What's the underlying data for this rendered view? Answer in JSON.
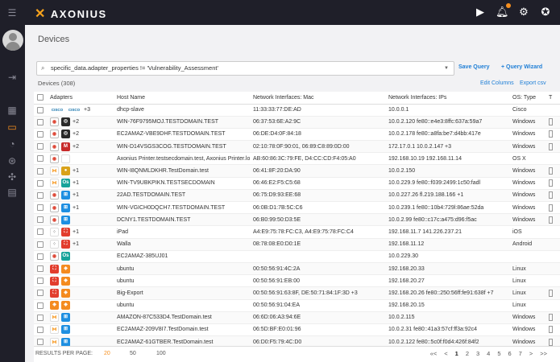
{
  "app": {
    "name": "AXONIUS"
  },
  "page": {
    "title": "Devices"
  },
  "query": {
    "value": "specific_data.adapter_properties != 'Vulnerability_Assessment'"
  },
  "actions": {
    "save_query": "Save Query",
    "query_wizard": "+ Query Wizard",
    "edit_columns": "Edit Columns",
    "export_csv": "Export csv"
  },
  "count_label": "Devices",
  "count_value": "(308)",
  "columns": [
    "Adapters",
    "Host Name",
    "Network Interfaces: Mac",
    "Network Interfaces: IPs",
    "OS: Type",
    "T"
  ],
  "rows": [
    {
      "icons": [
        "cisco",
        "cisco"
      ],
      "more": "+3",
      "host": "dhcp-slave",
      "mac": "11:33:33:77:DE:AD",
      "ips": "10.0.0.1",
      "os": "Cisco",
      "tag": false
    },
    {
      "icons": [
        "chrome",
        "eye"
      ],
      "more": "+2",
      "host": "WIN-76F9795MOJ.TESTDOMAIN.TEST",
      "mac": "06:37:53:6E:A2:9C",
      "ips": "10.0.2.120  fe80::e4e3:8ffc:637a:59a7",
      "os": "Windows",
      "tag": true
    },
    {
      "icons": [
        "chrome",
        "eye"
      ],
      "more": "+2",
      "host": "EC2AMAZ-VBE9DHF.TESTDOMAIN.TEST",
      "mac": "06:DE:D4:0F:84:18",
      "ips": "10.0.2.178  fe80::a8fa:be7:d4bb:417e",
      "os": "Windows",
      "tag": true
    },
    {
      "icons": [
        "chrome",
        "shield"
      ],
      "more": "+2",
      "host": "WIN-D14VSGS3COG.TESTDOMAIN.TEST",
      "mac": "02:10:78:0F:90:01, 06:89:C8:89:0D:00",
      "ips": "172.17.0.1  10.0.2.147  +3",
      "os": "Windows",
      "tag": true
    },
    {
      "icons": [
        "chrome",
        "apple"
      ],
      "more": "",
      "host": "Axonius Printer.testsecdomain.test, Axonius Printer.local",
      "mac": "AB:60:86:3C:79:FE, D4:CC:CD:F4:05:A0",
      "ips": "192.168.10.19  192.168.11.14",
      "os": "OS X",
      "tag": false
    },
    {
      "icons": [
        "aws",
        "gold"
      ],
      "more": "+1",
      "host": "WIN-I8QNMLDKHR.TestDomain.test",
      "mac": "06:41:8F:20:DA:90",
      "ips": "10.0.2.150",
      "os": "Windows",
      "tag": true
    },
    {
      "icons": [
        "aws",
        "teal"
      ],
      "more": "+1",
      "host": "WIN-TV9UBKPIKN.TESTSECDOMAIN",
      "mac": "06:46:E2:F5:C5:68",
      "ips": "10.0.229.9  fe80::f039:2499:1c50:fadl",
      "os": "Windows",
      "tag": true
    },
    {
      "icons": [
        "chrome",
        "windows"
      ],
      "more": "+1",
      "host": "22AD.TESTDOMAIN.TEST",
      "mac": "06:75:D9:93:EE:68",
      "ips": "10.0.227.26  fl.219.188.166  +1",
      "os": "Windows",
      "tag": true
    },
    {
      "icons": [
        "chrome",
        "windows"
      ],
      "more": "+1",
      "host": "WIN-VGICH0DQCH7.TESTDOMAIN.TEST",
      "mac": "06:0B:D1:7B:5C:C6",
      "ips": "10.0.239.1  fe80::10b4:729l:86ae:52da",
      "os": "Windows",
      "tag": true
    },
    {
      "icons": [
        "chrome",
        "windows"
      ],
      "more": "",
      "host": "DCNY1.TESTDOMAIN.TEST",
      "mac": "06:B0:99:50:D3:5E",
      "ips": "10.0.2.99  fe80::c17c:a475:d96:f5ac",
      "os": "Windows",
      "tag": true
    },
    {
      "icons": [
        "gear",
        "crowd"
      ],
      "more": "+1",
      "host": "iPad",
      "mac": "A4:E9:75:78:FC:C3, A4:E9:75:78:FC:C4",
      "ips": "192.168.11.7  141.226.237.21",
      "os": "iOS",
      "tag": false
    },
    {
      "icons": [
        "gear",
        "crowd"
      ],
      "more": "+1",
      "host": "Walla",
      "mac": "08:78:08:E0:D0:1E",
      "ips": "192.168.11.12",
      "os": "Android",
      "tag": false
    },
    {
      "icons": [
        "chrome",
        "teal"
      ],
      "more": "",
      "host": "EC2AMAZ-385UJ01",
      "mac": "",
      "ips": "10.0.229.30",
      "os": "",
      "tag": false
    },
    {
      "icons": [
        "crowd",
        "lens"
      ],
      "more": "",
      "host": "ubuntu",
      "mac": "00:50:56:91:4C:2A",
      "ips": "192.168.20.33",
      "os": "Linux",
      "tag": false
    },
    {
      "icons": [
        "crowd",
        "lens"
      ],
      "more": "",
      "host": "ubuntu",
      "mac": "00:50:56:91:EB:00",
      "ips": "192.168.20.27",
      "os": "Linux",
      "tag": false
    },
    {
      "icons": [
        "crowd",
        "lens"
      ],
      "more": "",
      "host": "Big-Export",
      "mac": "00:50:56:91:63:8F, DE:50:71:84:1F:3D +3",
      "ips": "192.168.20.26  fe80::250:56ff:fe91:638f  +7",
      "os": "Linux",
      "tag": true
    },
    {
      "icons": [
        "lens",
        "lens"
      ],
      "more": "",
      "host": "ubuntu",
      "mac": "00:50:56:91:04:EA",
      "ips": "192.168.20.15",
      "os": "Linux",
      "tag": false
    },
    {
      "icons": [
        "aws",
        "windows"
      ],
      "more": "",
      "host": "AMAZON-87C533D4.TestDomain.test",
      "mac": "06:6D:06:A3:94:6E",
      "ips": "10.0.2.115",
      "os": "Windows",
      "tag": true
    },
    {
      "icons": [
        "aws",
        "windows"
      ],
      "more": "",
      "host": "EC2AMAZ-209V8I7.TestDomain.test",
      "mac": "06:5D:BF:E0:01:96",
      "ips": "10.0.2.31  fe80::41a3:57cf:ff3a:92c4",
      "os": "Windows",
      "tag": true
    },
    {
      "icons": [
        "aws",
        "windows"
      ],
      "more": "",
      "host": "EC2AMAZ-61GTBER.TestDomain.test",
      "mac": "06:D0:F5:79:4C:D0",
      "ips": "10.0.2.122  fe80::5c0f:f0d4:426f:84f2",
      "os": "Windows",
      "tag": true
    }
  ],
  "footer": {
    "results_per_page": "RESULTS PER PAGE:",
    "sizes": [
      "20",
      "50",
      "100"
    ],
    "pages": [
      "«<",
      "<",
      "1",
      "2",
      "3",
      "4",
      "5",
      "6",
      "7",
      ">",
      ">>"
    ]
  },
  "icon_glyphs": {
    "cisco": "CISCO",
    "chrome": "◉",
    "eye": "◎",
    "shield": "M",
    "apple": "",
    "aws": "⋈",
    "gold": "●",
    "teal": "Os",
    "windows": "⊞",
    "gear": "⁘",
    "crowd": "⛶",
    "lens": "◈"
  }
}
